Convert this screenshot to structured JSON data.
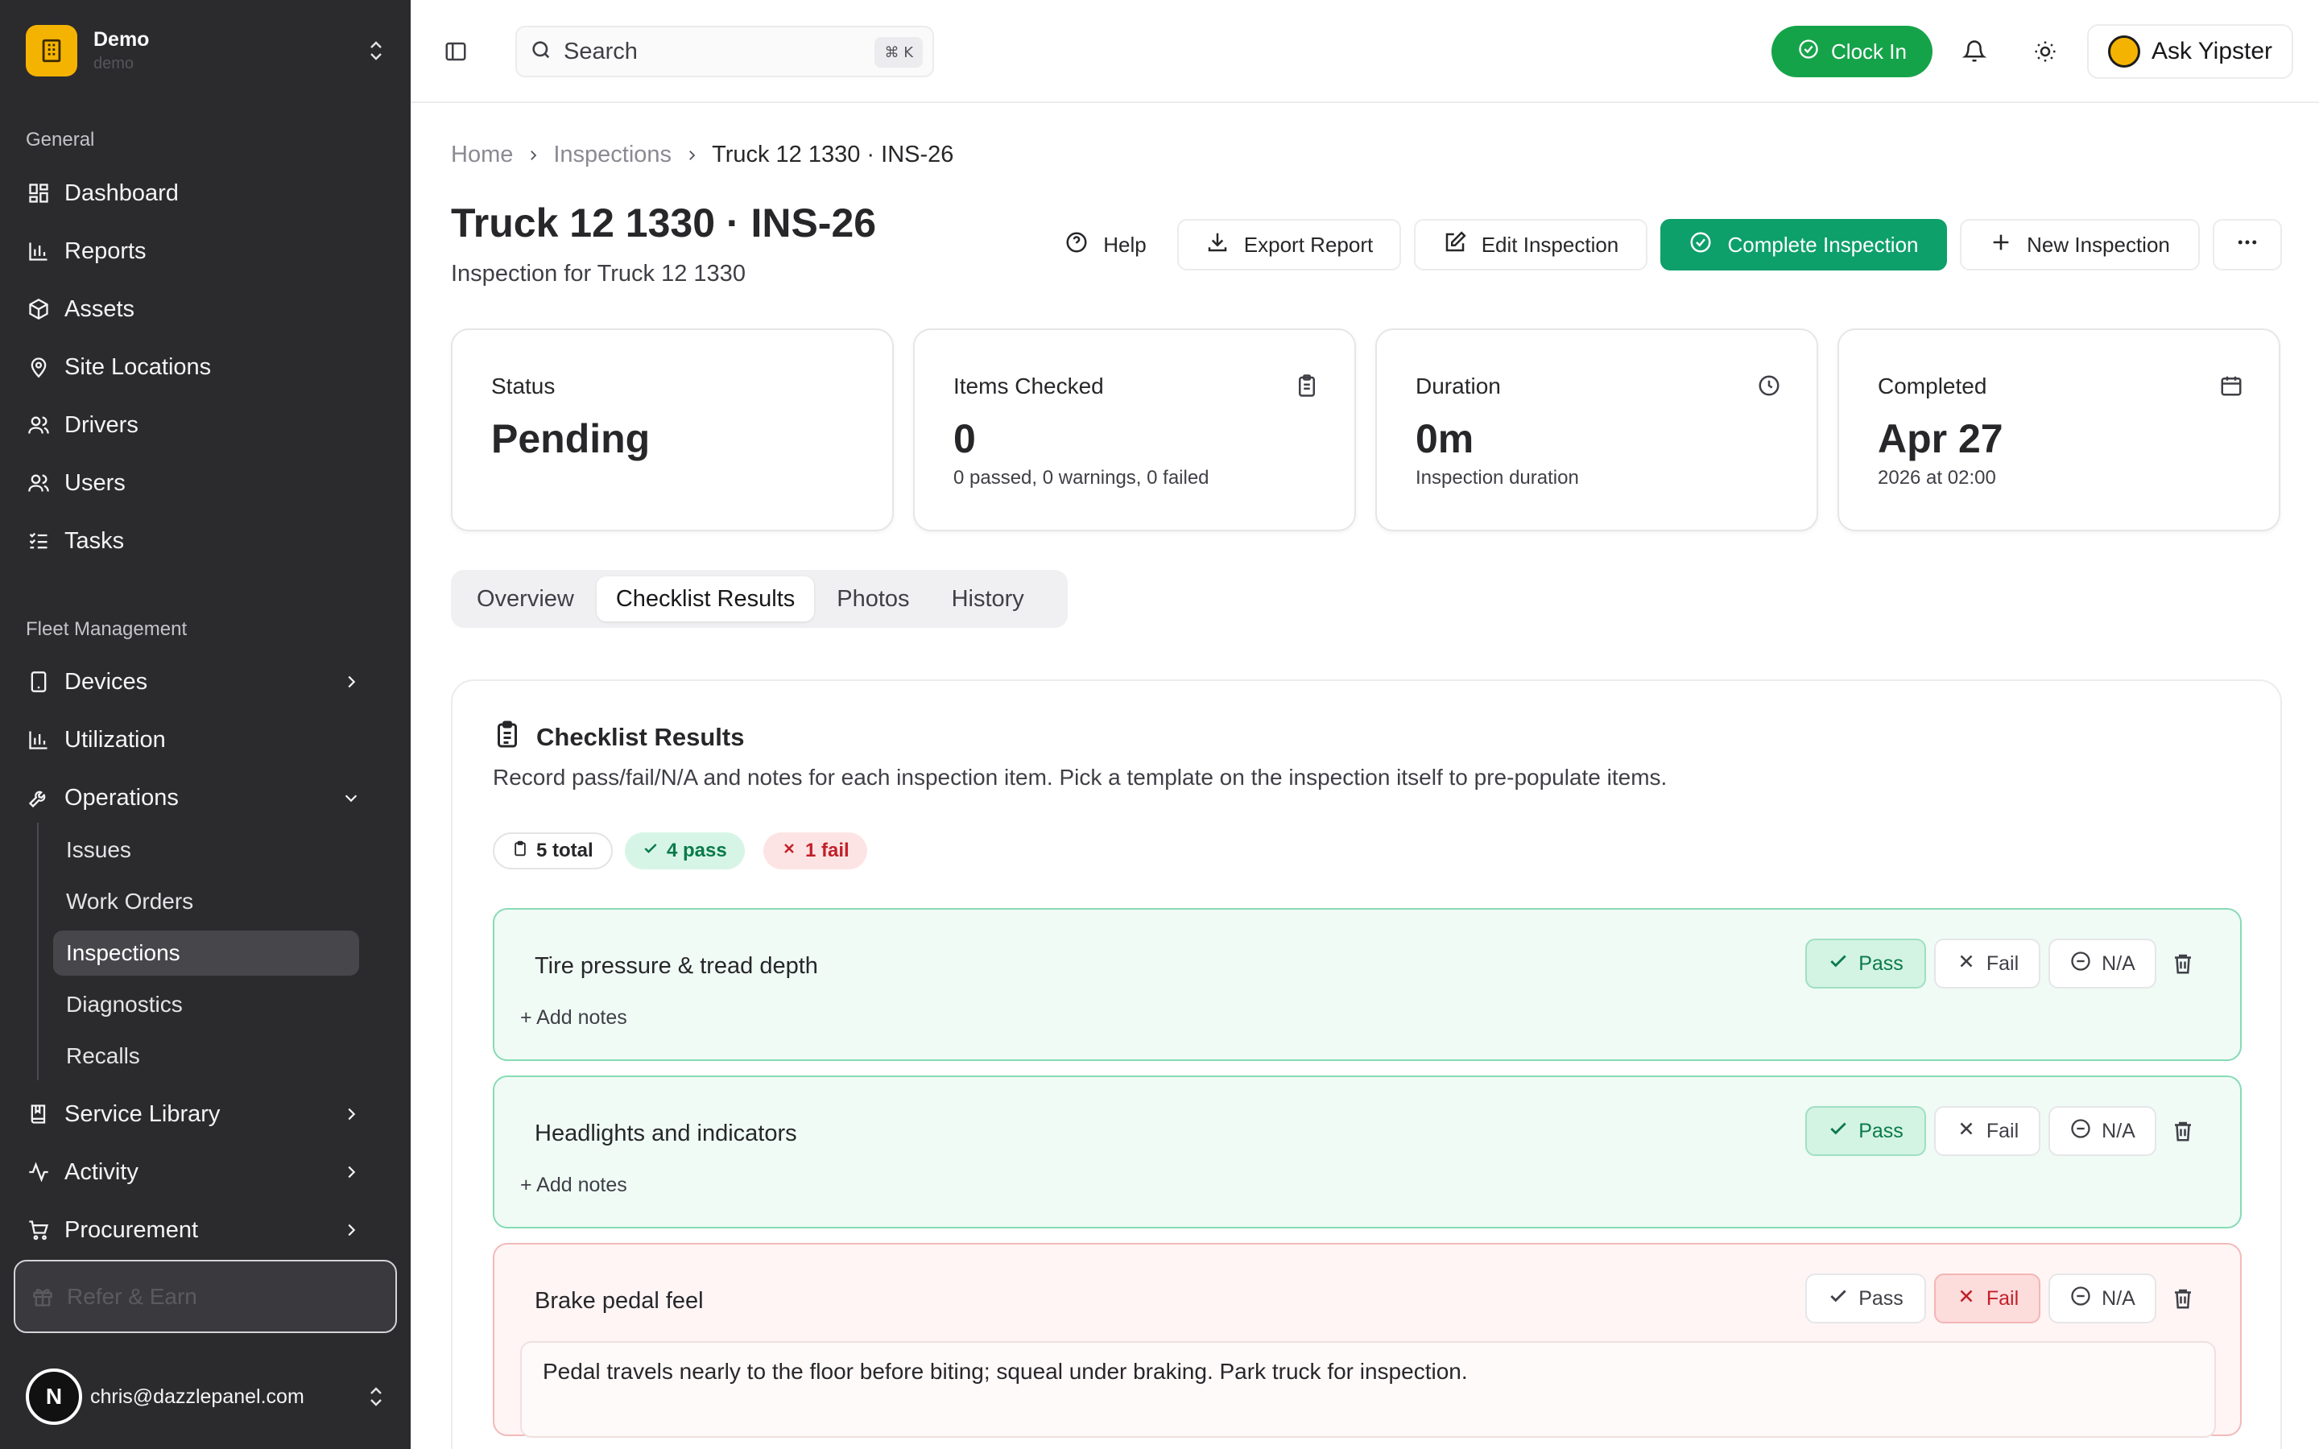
{
  "sidebar": {
    "org_name": "Demo",
    "org_sub": "demo",
    "general_label": "General",
    "general_items": [
      {
        "label": "Dashboard",
        "icon": "dashboard-icon"
      },
      {
        "label": "Reports",
        "icon": "bar-chart-icon"
      },
      {
        "label": "Assets",
        "icon": "box-icon"
      },
      {
        "label": "Site Locations",
        "icon": "map-pin-icon"
      },
      {
        "label": "Drivers",
        "icon": "users-icon"
      },
      {
        "label": "Users",
        "icon": "users-icon"
      },
      {
        "label": "Tasks",
        "icon": "list-checks-icon"
      }
    ],
    "fleet_label": "Fleet Management",
    "fleet_items": [
      {
        "label": "Devices",
        "icon": "tablet-icon"
      },
      {
        "label": "Utilization",
        "icon": "bar-chart-icon"
      },
      {
        "label": "Operations",
        "icon": "wrench-icon"
      }
    ],
    "operations_sub": [
      "Issues",
      "Work Orders",
      "Inspections",
      "Diagnostics",
      "Recalls"
    ],
    "active_sub": "Inspections",
    "more_items": [
      {
        "label": "Service Library",
        "icon": "book-icon"
      },
      {
        "label": "Activity",
        "icon": "activity-icon"
      },
      {
        "label": "Procurement",
        "icon": "cart-icon"
      }
    ],
    "refer_label": "Refer & Earn",
    "user_initial": "N",
    "user_email": "chris@dazzlepanel.com"
  },
  "topbar": {
    "search_placeholder": "Search",
    "search_shortcut": "⌘ K",
    "clock_in_label": "Clock In",
    "ask_label": "Ask Yipster"
  },
  "breadcrumb": [
    "Home",
    "Inspections",
    "Truck 12 1330 · INS-26"
  ],
  "header": {
    "title": "Truck 12 1330 · INS-26",
    "subtitle": "Inspection for Truck 12 1330",
    "help_label": "Help",
    "export_label": "Export Report",
    "edit_label": "Edit Inspection",
    "complete_label": "Complete Inspection",
    "new_label": "New Inspection"
  },
  "stats": [
    {
      "label": "Status",
      "value": "Pending",
      "note": "",
      "icon": ""
    },
    {
      "label": "Items Checked",
      "value": "0",
      "note": "0 passed, 0 warnings, 0 failed",
      "icon": "clipboard-icon"
    },
    {
      "label": "Duration",
      "value": "0m",
      "note": "Inspection duration",
      "icon": "clock-icon"
    },
    {
      "label": "Completed",
      "value": "Apr 27",
      "note": "2026 at 02:00",
      "icon": "calendar-icon"
    }
  ],
  "tabs": [
    "Overview",
    "Checklist Results",
    "Photos",
    "History"
  ],
  "active_tab": "Checklist Results",
  "checklist": {
    "title": "Checklist Results",
    "description": "Record pass/fail/N/A and notes for each inspection item. Pick a template on the inspection itself to pre-populate items.",
    "total_chip": "5 total",
    "pass_chip": "4 pass",
    "fail_chip": "1 fail",
    "pass_label": "Pass",
    "fail_label": "Fail",
    "na_label": "N/A",
    "add_notes_label": "+ Add notes",
    "items": [
      {
        "name": "Tire pressure & tread depth",
        "result": "pass",
        "notes": ""
      },
      {
        "name": "Headlights and indicators",
        "result": "pass",
        "notes": ""
      },
      {
        "name": "Brake pedal feel",
        "result": "fail",
        "notes": "Pedal travels nearly to the floor before biting; squeal under braking. Park truck for inspection."
      }
    ]
  },
  "colors": {
    "sidebar_bg": "#2b2b2e",
    "accent_green": "#0ea06a",
    "clock_in_green": "#15a34a",
    "org_logo": "#f5b301",
    "fail_red": "#c2202a"
  }
}
